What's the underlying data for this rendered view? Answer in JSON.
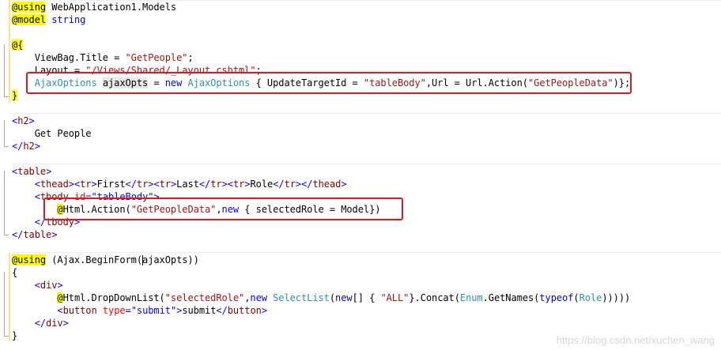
{
  "editor": {
    "lines": [
      {
        "parts": [
          {
            "t": "@using",
            "c": "razor"
          },
          {
            "t": " WebApplication1.Models"
          }
        ]
      },
      {
        "parts": [
          {
            "t": "@model",
            "c": "razor"
          },
          {
            "t": " "
          },
          {
            "t": "string",
            "c": "kw"
          }
        ]
      },
      {
        "parts": [
          {
            "t": ""
          }
        ]
      },
      {
        "parts": [
          {
            "t": "@{",
            "c": "razor"
          }
        ]
      },
      {
        "parts": [
          {
            "t": "    ViewBag.Title = "
          },
          {
            "t": "\"GetPeople\"",
            "c": "str"
          },
          {
            "t": ";"
          }
        ]
      },
      {
        "parts": [
          {
            "t": "    Layout = "
          },
          {
            "t": "\"/Views/Shared/_Layout.cshtml\"",
            "c": "str"
          },
          {
            "t": ";"
          }
        ]
      },
      {
        "parts": [
          {
            "t": "    "
          },
          {
            "t": "AjaxOptions",
            "c": "type"
          },
          {
            "t": " "
          },
          {
            "t": "ajaxOpts",
            "c": "hl"
          },
          {
            "t": " = "
          },
          {
            "t": "new",
            "c": "kw"
          },
          {
            "t": " "
          },
          {
            "t": "AjaxOptions",
            "c": "type"
          },
          {
            "t": " { UpdateTargetId = "
          },
          {
            "t": "\"tableBody\"",
            "c": "str"
          },
          {
            "t": ",Url = Url.Action("
          },
          {
            "t": "\"GetPeopleData\"",
            "c": "str"
          },
          {
            "t": ")};"
          }
        ]
      },
      {
        "parts": [
          {
            "t": "}",
            "c": "razor"
          }
        ]
      },
      {
        "parts": [
          {
            "t": ""
          }
        ]
      },
      {
        "parts": [
          {
            "t": "<",
            "c": "kw"
          },
          {
            "t": "h2",
            "c": "tag"
          },
          {
            "t": ">",
            "c": "kw"
          }
        ]
      },
      {
        "parts": [
          {
            "t": "    Get People"
          }
        ]
      },
      {
        "parts": [
          {
            "t": "</",
            "c": "kw"
          },
          {
            "t": "h2",
            "c": "tag"
          },
          {
            "t": ">",
            "c": "kw"
          }
        ]
      },
      {
        "parts": [
          {
            "t": ""
          }
        ]
      },
      {
        "parts": [
          {
            "t": "<",
            "c": "kw"
          },
          {
            "t": "table",
            "c": "tag"
          },
          {
            "t": ">",
            "c": "kw"
          }
        ]
      },
      {
        "parts": [
          {
            "t": "    "
          },
          {
            "t": "<",
            "c": "kw"
          },
          {
            "t": "thead",
            "c": "tag"
          },
          {
            "t": "><",
            "c": "kw"
          },
          {
            "t": "tr",
            "c": "tag"
          },
          {
            "t": ">",
            "c": "kw"
          },
          {
            "t": "First"
          },
          {
            "t": "</",
            "c": "kw"
          },
          {
            "t": "tr",
            "c": "tag"
          },
          {
            "t": "><",
            "c": "kw"
          },
          {
            "t": "tr",
            "c": "tag"
          },
          {
            "t": ">",
            "c": "kw"
          },
          {
            "t": "Last"
          },
          {
            "t": "</",
            "c": "kw"
          },
          {
            "t": "tr",
            "c": "tag"
          },
          {
            "t": "><",
            "c": "kw"
          },
          {
            "t": "tr",
            "c": "tag"
          },
          {
            "t": ">",
            "c": "kw"
          },
          {
            "t": "Role"
          },
          {
            "t": "</",
            "c": "kw"
          },
          {
            "t": "tr",
            "c": "tag"
          },
          {
            "t": "></",
            "c": "kw"
          },
          {
            "t": "thead",
            "c": "tag"
          },
          {
            "t": ">",
            "c": "kw"
          }
        ]
      },
      {
        "parts": [
          {
            "t": "    "
          },
          {
            "t": "<",
            "c": "kw"
          },
          {
            "t": "tbody",
            "c": "tag"
          },
          {
            "t": " "
          },
          {
            "t": "id",
            "c": "attr"
          },
          {
            "t": "=",
            "c": "kw"
          },
          {
            "t": "\"tableBody\"",
            "c": "attrv"
          },
          {
            "t": ">",
            "c": "kw"
          }
        ]
      },
      {
        "parts": [
          {
            "t": "        "
          },
          {
            "t": "@",
            "c": "razor"
          },
          {
            "t": "Html.Action("
          },
          {
            "t": "\"GetPeopleData\"",
            "c": "str"
          },
          {
            "t": ","
          },
          {
            "t": "new",
            "c": "kw"
          },
          {
            "t": " { selectedRole = Model})"
          }
        ]
      },
      {
        "parts": [
          {
            "t": "    "
          },
          {
            "t": "</",
            "c": "kw"
          },
          {
            "t": "tbody",
            "c": "tag"
          },
          {
            "t": ">",
            "c": "kw"
          }
        ]
      },
      {
        "parts": [
          {
            "t": "</",
            "c": "kw"
          },
          {
            "t": "table",
            "c": "tag"
          },
          {
            "t": ">",
            "c": "kw"
          }
        ]
      },
      {
        "parts": [
          {
            "t": ""
          }
        ]
      },
      {
        "parts": [
          {
            "t": "@using",
            "c": "razor"
          },
          {
            "t": " (Ajax.BeginForm("
          },
          {
            "t": "|",
            "c": "caret"
          },
          {
            "t": "ajaxOpts))"
          }
        ]
      },
      {
        "parts": [
          {
            "t": "{"
          }
        ]
      },
      {
        "parts": [
          {
            "t": "    "
          },
          {
            "t": "<",
            "c": "kw"
          },
          {
            "t": "div",
            "c": "tag"
          },
          {
            "t": ">",
            "c": "kw"
          }
        ]
      },
      {
        "parts": [
          {
            "t": "        "
          },
          {
            "t": "@",
            "c": "razor"
          },
          {
            "t": "Html.DropDownList("
          },
          {
            "t": "\"selectedRole\"",
            "c": "str"
          },
          {
            "t": ","
          },
          {
            "t": "new",
            "c": "kw"
          },
          {
            "t": " "
          },
          {
            "t": "SelectList",
            "c": "type"
          },
          {
            "t": "("
          },
          {
            "t": "new",
            "c": "kw"
          },
          {
            "t": "[] { "
          },
          {
            "t": "\"ALL\"",
            "c": "str"
          },
          {
            "t": "}.Concat("
          },
          {
            "t": "Enum",
            "c": "type"
          },
          {
            "t": ".GetNames("
          },
          {
            "t": "typeof",
            "c": "kw"
          },
          {
            "t": "("
          },
          {
            "t": "Role",
            "c": "type"
          },
          {
            "t": ")))))"
          }
        ]
      },
      {
        "parts": [
          {
            "t": "        "
          },
          {
            "t": "<",
            "c": "kw"
          },
          {
            "t": "button",
            "c": "tag"
          },
          {
            "t": " "
          },
          {
            "t": "type",
            "c": "attr"
          },
          {
            "t": "=",
            "c": "kw"
          },
          {
            "t": "\"submit\"",
            "c": "attrv"
          },
          {
            "t": ">",
            "c": "kw"
          },
          {
            "t": "submit"
          },
          {
            "t": "</",
            "c": "kw"
          },
          {
            "t": "button",
            "c": "tag"
          },
          {
            "t": ">",
            "c": "kw"
          }
        ]
      },
      {
        "parts": [
          {
            "t": "    "
          },
          {
            "t": "</",
            "c": "kw"
          },
          {
            "t": "div",
            "c": "tag"
          },
          {
            "t": ">",
            "c": "kw"
          }
        ]
      },
      {
        "parts": [
          {
            "t": "}"
          }
        ]
      }
    ]
  },
  "watermark": "https://blog.csdn.net/xuchen_wang",
  "colors": {
    "keyword": "#0000ff",
    "string": "#a31515",
    "type": "#2b91af",
    "tag": "#800000",
    "attribute": "#ff0000",
    "razor_highlight": "#ffff00",
    "annotation_box": "#e0181f"
  }
}
